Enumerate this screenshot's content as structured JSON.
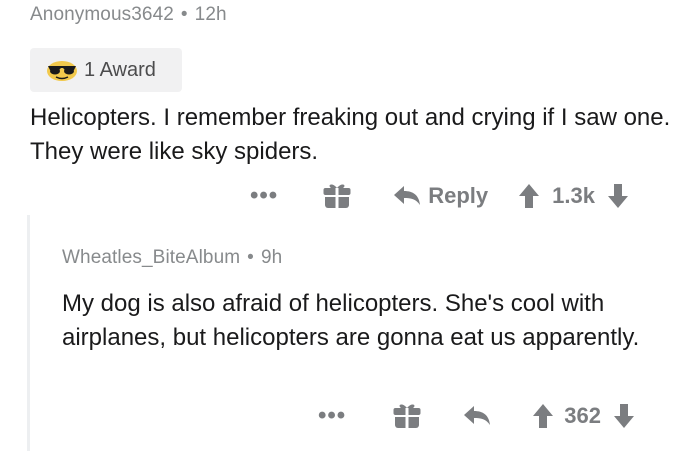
{
  "comment": {
    "author": "Anonymous3642",
    "separator": "•",
    "time": "12h",
    "award_label": "1 Award",
    "body": "Helicopters. I remember freaking out and crying if I saw one. They were like sky spiders.",
    "actions": {
      "more": "•••",
      "reply_label": "Reply",
      "score": "1.3k"
    }
  },
  "reply": {
    "author": "Wheatles_BiteAlbum",
    "separator": "•",
    "time": "9h",
    "body": "My dog is also afraid of helicopters. She's cool with airplanes, but helicopters are gonna eat us apparently.",
    "actions": {
      "more": "•••",
      "score": "362"
    }
  },
  "icons": {
    "award": "sunglasses-award-icon",
    "give_award": "gift-icon",
    "reply": "reply-arrow-icon",
    "upvote": "upvote-arrow-icon",
    "downvote": "downvote-arrow-icon",
    "more": "more-options-icon"
  },
  "colors": {
    "text": "#1a1a1b",
    "meta": "#878a8c",
    "action": "#7b7d80",
    "award_bg": "#f1f1f2",
    "thread_line": "#edeff1"
  }
}
